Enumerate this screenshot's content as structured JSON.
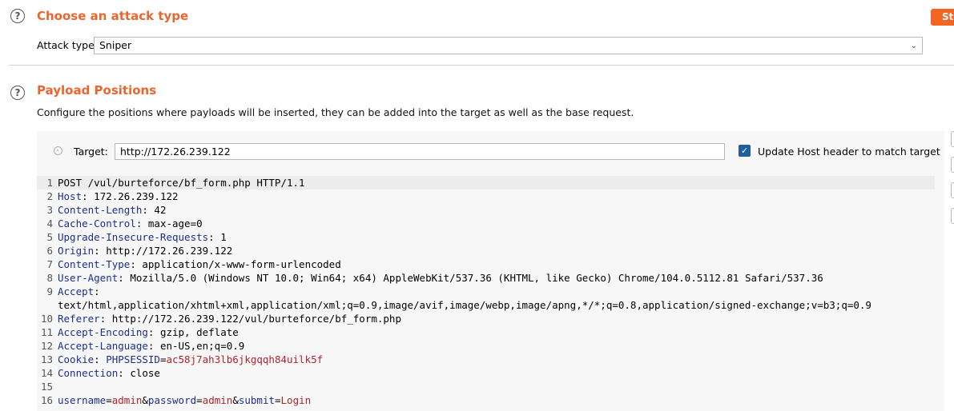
{
  "attack_section": {
    "title": "Choose an attack type",
    "attack_type_label": "Attack type:",
    "attack_type_value": "Sniper",
    "start_button_label": "Start attack"
  },
  "payload_section": {
    "title": "Payload Positions",
    "description": "Configure the positions where payloads will be inserted, they can be added into the target as well as the base request.",
    "target_label": "Target:",
    "target_value": "http://172.26.239.122",
    "update_host_label": "Update Host header to match target",
    "update_host_checked": true
  },
  "request_lines": [
    {
      "n": "1",
      "key": "",
      "sep": "",
      "val": "POST /vul/burteforce/bf_form.php HTTP/1.1"
    },
    {
      "n": "2",
      "key": "Host",
      "sep": ": ",
      "val": "172.26.239.122"
    },
    {
      "n": "3",
      "key": "Content-Length",
      "sep": ": ",
      "val": "42"
    },
    {
      "n": "4",
      "key": "Cache-Control",
      "sep": ": ",
      "val": "max-age=0"
    },
    {
      "n": "5",
      "key": "Upgrade-Insecure-Requests",
      "sep": ": ",
      "val": "1"
    },
    {
      "n": "6",
      "key": "Origin",
      "sep": ": ",
      "val": "http://172.26.239.122"
    },
    {
      "n": "7",
      "key": "Content-Type",
      "sep": ": ",
      "val": "application/x-www-form-urlencoded"
    },
    {
      "n": "8",
      "key": "User-Agent",
      "sep": ": ",
      "val": "Mozilla/5.0 (Windows NT 10.0; Win64; x64) AppleWebKit/537.36 (KHTML, like Gecko) Chrome/104.0.5112.81 Safari/537.36"
    },
    {
      "n": "9",
      "key": "Accept",
      "sep": ":",
      "val": ""
    },
    {
      "n": "",
      "key": "",
      "sep": "",
      "val": "text/html,application/xhtml+xml,application/xml;q=0.9,image/avif,image/webp,image/apng,*/*;q=0.8,application/signed-exchange;v=b3;q=0.9"
    },
    {
      "n": "10",
      "key": "Referer",
      "sep": ": ",
      "val": "http://172.26.239.122/vul/burteforce/bf_form.php"
    },
    {
      "n": "11",
      "key": "Accept-Encoding",
      "sep": ": ",
      "val": "gzip, deflate"
    },
    {
      "n": "12",
      "key": "Accept-Language",
      "sep": ": ",
      "val": "en-US,en;q=0.9"
    },
    {
      "n": "13",
      "key": "Cookie",
      "sep": ": ",
      "val": "",
      "cookie_name": "PHPSESSID",
      "cookie_value": "ac58j7ah3lb6jkgqqh84uilk5f"
    },
    {
      "n": "14",
      "key": "Connection",
      "sep": ": ",
      "val": "close"
    },
    {
      "n": "15",
      "key": "",
      "sep": "",
      "val": ""
    },
    {
      "n": "16",
      "key": "",
      "sep": "",
      "val": "",
      "body": [
        [
          "username",
          "admin"
        ],
        [
          "password",
          "admin"
        ],
        [
          "submit",
          "Login"
        ]
      ]
    }
  ],
  "colors": {
    "accent": "#e8662f",
    "header_key": "#1d2f8c",
    "param_value": "#b0232a",
    "checkbox": "#1f5f9e"
  }
}
